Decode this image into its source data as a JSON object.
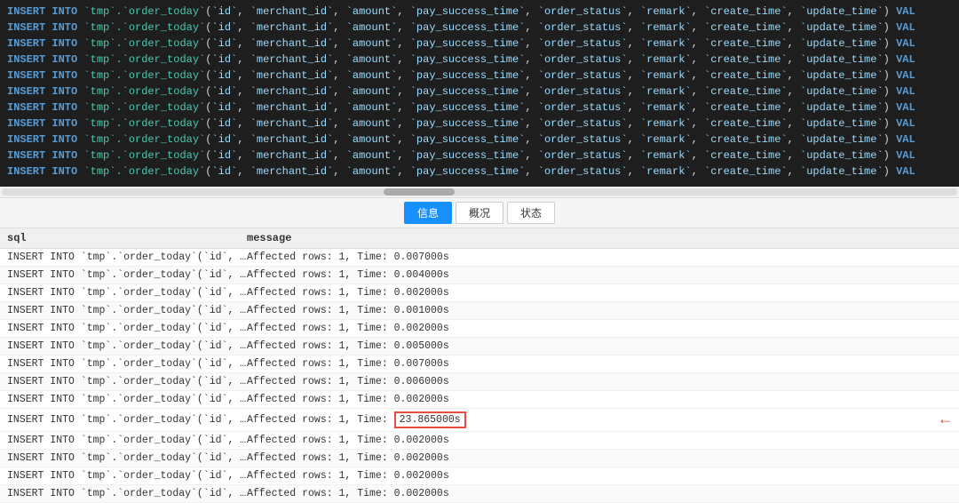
{
  "codeArea": {
    "lines": [
      "INSERT INTO `tmp`.`order_today`(`id`, `merchant_id`, `amount`, `pay_success_time`, `order_status`, `remark`, `create_time`, `update_time`) VAL",
      "INSERT INTO `tmp`.`order_today`(`id`, `merchant_id`, `amount`, `pay_success_time`, `order_status`, `remark`, `create_time`, `update_time`) VAL",
      "INSERT INTO `tmp`.`order_today`(`id`, `merchant_id`, `amount`, `pay_success_time`, `order_status`, `remark`, `create_time`, `update_time`) VAL",
      "INSERT INTO `tmp`.`order_today`(`id`, `merchant_id`, `amount`, `pay_success_time`, `order_status`, `remark`, `create_time`, `update_time`) VAL",
      "INSERT INTO `tmp`.`order_today`(`id`, `merchant_id`, `amount`, `pay_success_time`, `order_status`, `remark`, `create_time`, `update_time`) VAL",
      "INSERT INTO `tmp`.`order_today`(`id`, `merchant_id`, `amount`, `pay_success_time`, `order_status`, `remark`, `create_time`, `update_time`) VAL",
      "INSERT INTO `tmp`.`order_today`(`id`, `merchant_id`, `amount`, `pay_success_time`, `order_status`, `remark`, `create_time`, `update_time`) VAL",
      "INSERT INTO `tmp`.`order_today`(`id`, `merchant_id`, `amount`, `pay_success_time`, `order_status`, `remark`, `create_time`, `update_time`) VAL",
      "INSERT INTO `tmp`.`order_today`(`id`, `merchant_id`, `amount`, `pay_success_time`, `order_status`, `remark`, `create_time`, `update_time`) VAL",
      "INSERT INTO `tmp`.`order_today`(`id`, `merchant_id`, `amount`, `pay_success_time`, `order_status`, `remark`, `create_time`, `update_time`) VAL",
      "INSERT INTO `tmp`.`order_today`(`id`, `merchant_id`, `amount`, `pay_success_time`, `order_status`, `remark`, `create_time`, `update_time`) VAL"
    ]
  },
  "tabs": [
    {
      "label": "信息",
      "active": true
    },
    {
      "label": "概况",
      "active": false
    },
    {
      "label": "状态",
      "active": false
    }
  ],
  "tableHeader": {
    "sqlLabel": "sql",
    "messageLabel": "message"
  },
  "resultRows": [
    {
      "sql": "INSERT INTO `tmp`.`order_today`(`id`, `me...",
      "message": "Affected rows: 1, Time: 0.007000s",
      "highlighted": false,
      "highlightTime": null
    },
    {
      "sql": "INSERT INTO `tmp`.`order_today`(`id`, `me...",
      "message": "Affected rows: 1, Time: 0.004000s",
      "highlighted": false,
      "highlightTime": null
    },
    {
      "sql": "INSERT INTO `tmp`.`order_today`(`id`, `me...",
      "message": "Affected rows: 1, Time: 0.002000s",
      "highlighted": false,
      "highlightTime": null
    },
    {
      "sql": "INSERT INTO `tmp`.`order_today`(`id`, `me...",
      "message": "Affected rows: 1, Time: 0.001000s",
      "highlighted": false,
      "highlightTime": null
    },
    {
      "sql": "INSERT INTO `tmp`.`order_today`(`id`, `me...",
      "message": "Affected rows: 1, Time: 0.002000s",
      "highlighted": false,
      "highlightTime": null
    },
    {
      "sql": "INSERT INTO `tmp`.`order_today`(`id`, `me...",
      "message": "Affected rows: 1, Time: 0.005000s",
      "highlighted": false,
      "highlightTime": null
    },
    {
      "sql": "INSERT INTO `tmp`.`order_today`(`id`, `me...",
      "message": "Affected rows: 1, Time: 0.007000s",
      "highlighted": false,
      "highlightTime": null
    },
    {
      "sql": "INSERT INTO `tmp`.`order_today`(`id`, `me...",
      "message": "Affected rows: 1, Time: 0.006000s",
      "highlighted": false,
      "highlightTime": null
    },
    {
      "sql": "INSERT INTO `tmp`.`order_today`(`id`, `merch...",
      "message": "Affected rows: 1, Time: 0.002000s",
      "highlighted": false,
      "highlightTime": null
    },
    {
      "sql": "INSERT INTO `tmp`.`order_today`(`id`, `merch...",
      "message": "Affected rows: 1, Time: ",
      "highlighted": true,
      "highlightTime": "23.865000s"
    },
    {
      "sql": "INSERT INTO `tmp`.`order_today`(`id`, `merch...",
      "message": "Affected rows: 1, Time: 0.002000s",
      "highlighted": false,
      "highlightTime": null
    },
    {
      "sql": "INSERT INTO `tmp`.`order_today`(`id`, `merch...",
      "message": "Affected rows: 1, Time: 0.002000s",
      "highlighted": false,
      "highlightTime": null
    },
    {
      "sql": "INSERT INTO `tmp`.`order_today`(`id`, `merch...",
      "message": "Affected rows: 1, Time: 0.002000s",
      "highlighted": false,
      "highlightTime": null
    },
    {
      "sql": "INSERT INTO `tmp`.`order_today`(`id`, `merch...",
      "message": "Affected rows: 1, Time: 0.002000s",
      "highlighted": false,
      "highlightTime": null
    }
  ]
}
